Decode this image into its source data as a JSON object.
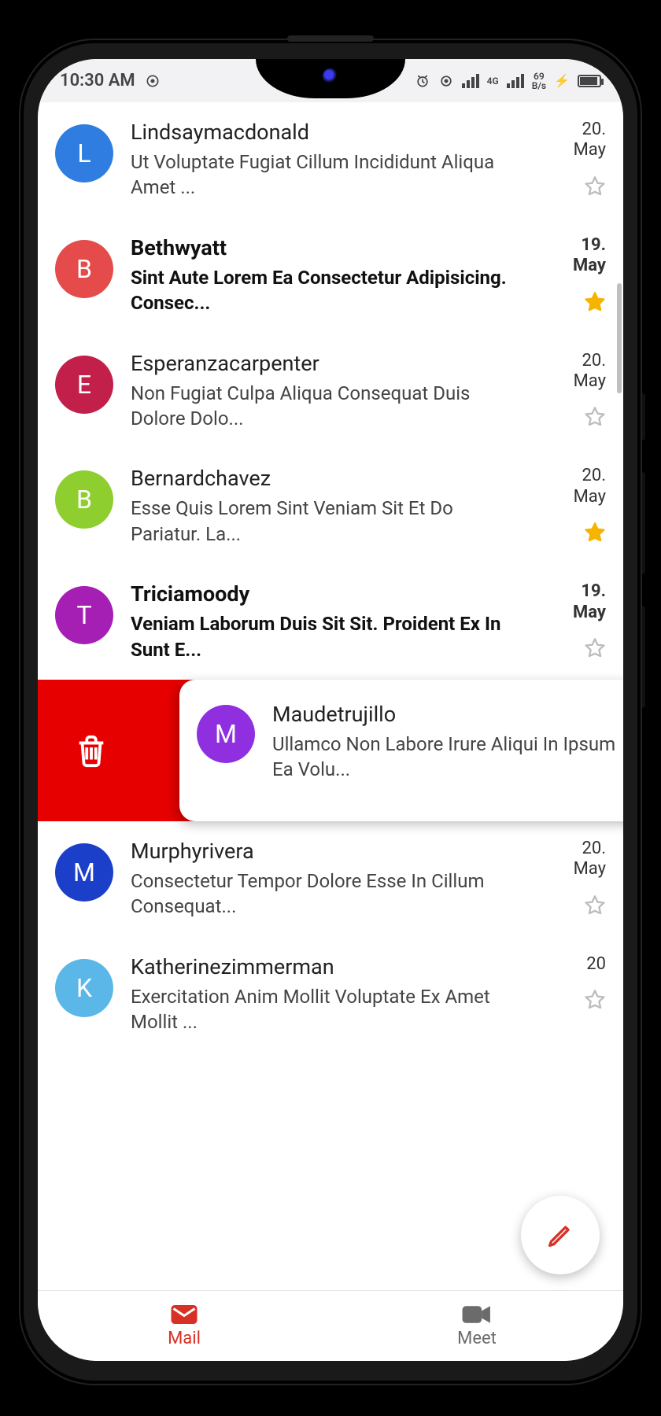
{
  "status": {
    "time": "10:30 AM",
    "net_speed_top": "69",
    "net_speed_unit": "B/s",
    "net_label": "4G"
  },
  "emails": [
    {
      "sender": "Lindsaymacdonald",
      "initial": "L",
      "color": "#2f7de1",
      "preview": "Ut Voluptate Fugiat Cillum Incididunt Aliqua Amet ...",
      "date": "20. May",
      "starred": false,
      "unread": false
    },
    {
      "sender": "Bethwyatt",
      "initial": "B",
      "color": "#e54b4b",
      "preview": "Sint Aute Lorem Ea Consectetur Adipisicing. Consec...",
      "date": "19. May",
      "starred": true,
      "unread": true
    },
    {
      "sender": "Esperanzacarpenter",
      "initial": "E",
      "color": "#c21f4a",
      "preview": "Non Fugiat Culpa Aliqua Consequat Duis Dolore Dolo...",
      "date": "20. May",
      "starred": false,
      "unread": false
    },
    {
      "sender": "Bernardchavez",
      "initial": "B",
      "color": "#8fce2f",
      "preview": "Esse Quis Lorem Sint Veniam Sit Et Do Pariatur. La...",
      "date": "20. May",
      "starred": true,
      "unread": false
    },
    {
      "sender": "Triciamoody",
      "initial": "T",
      "color": "#a51fb5",
      "preview": "Veniam Laborum Duis Sit Sit. Proident Ex In Sunt E...",
      "date": "19. May",
      "starred": false,
      "unread": true
    }
  ],
  "swiped": {
    "sender": "Maudetrujillo",
    "initial": "M",
    "color": "#8f2fe0",
    "preview": "Ullamco Non Labore Irure Aliqui In Ipsum Ea Volu..."
  },
  "emails_after": [
    {
      "sender": "Murphyrivera",
      "initial": "M",
      "color": "#1b3fc9",
      "preview": "Consectetur Tempor Dolore Esse In Cillum Consequat...",
      "date": "20. May",
      "starred": false,
      "unread": false
    },
    {
      "sender": "Katherinezimmerman",
      "initial": "K",
      "color": "#5bb7e8",
      "preview": "Exercitation Anim Mollit Voluptate Ex Amet Mollit ...",
      "date": "20",
      "starred": false,
      "unread": false
    }
  ],
  "nav": {
    "mail": "Mail",
    "meet": "Meet"
  }
}
